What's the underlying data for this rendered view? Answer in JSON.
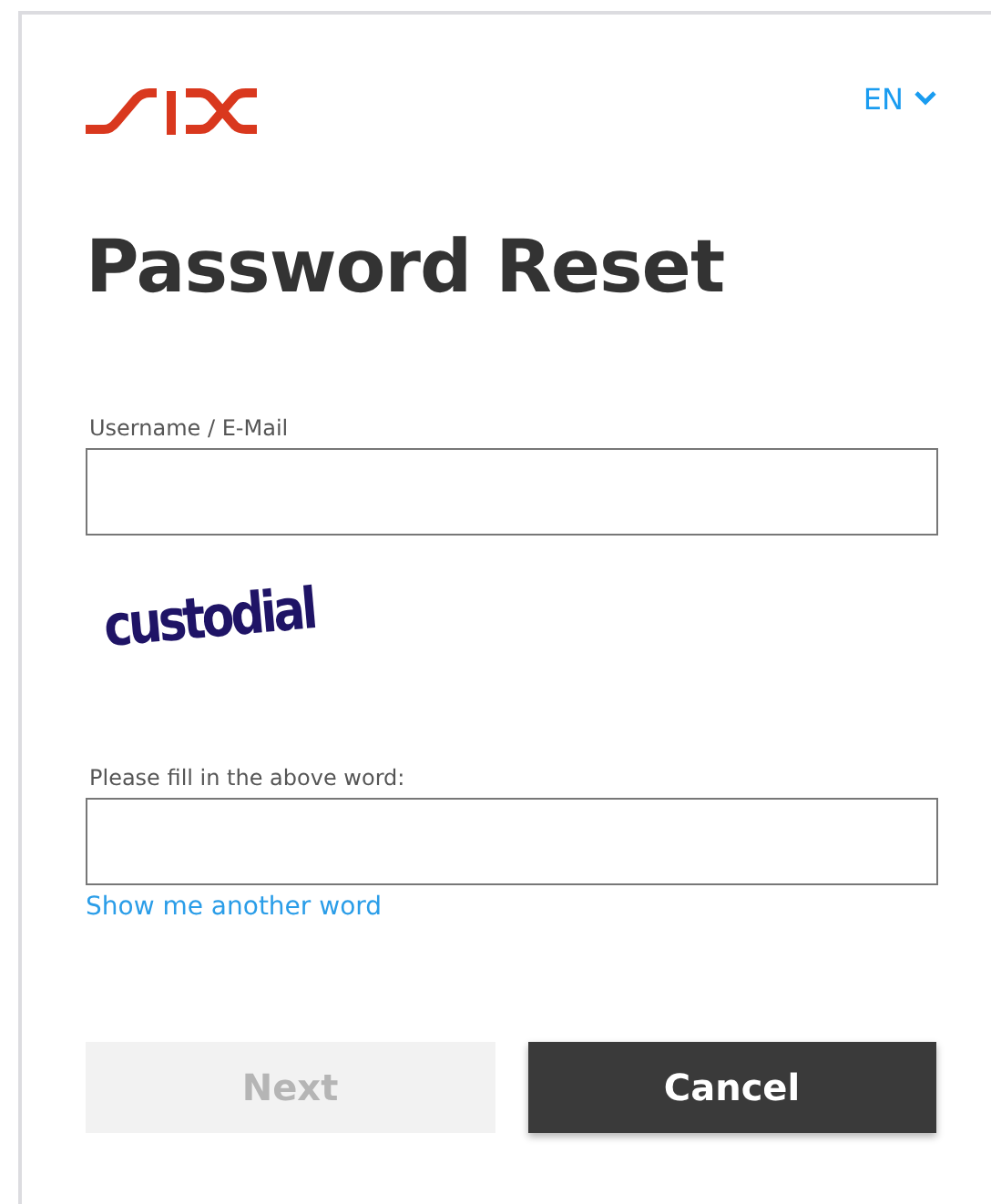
{
  "language": {
    "label": "EN"
  },
  "title": "Password Reset",
  "fields": [
    {
      "label": "Username / E-Mail"
    },
    {
      "kind": "captcha",
      "word": "custodial"
    },
    {
      "label": "Please fill in the above word:"
    }
  ],
  "link": "Show me another word",
  "buttons": [
    {
      "label": "Next",
      "kind": "secondary",
      "disabled": true
    },
    {
      "label": "Cancel",
      "kind": "primary",
      "disabled": false
    }
  ]
}
